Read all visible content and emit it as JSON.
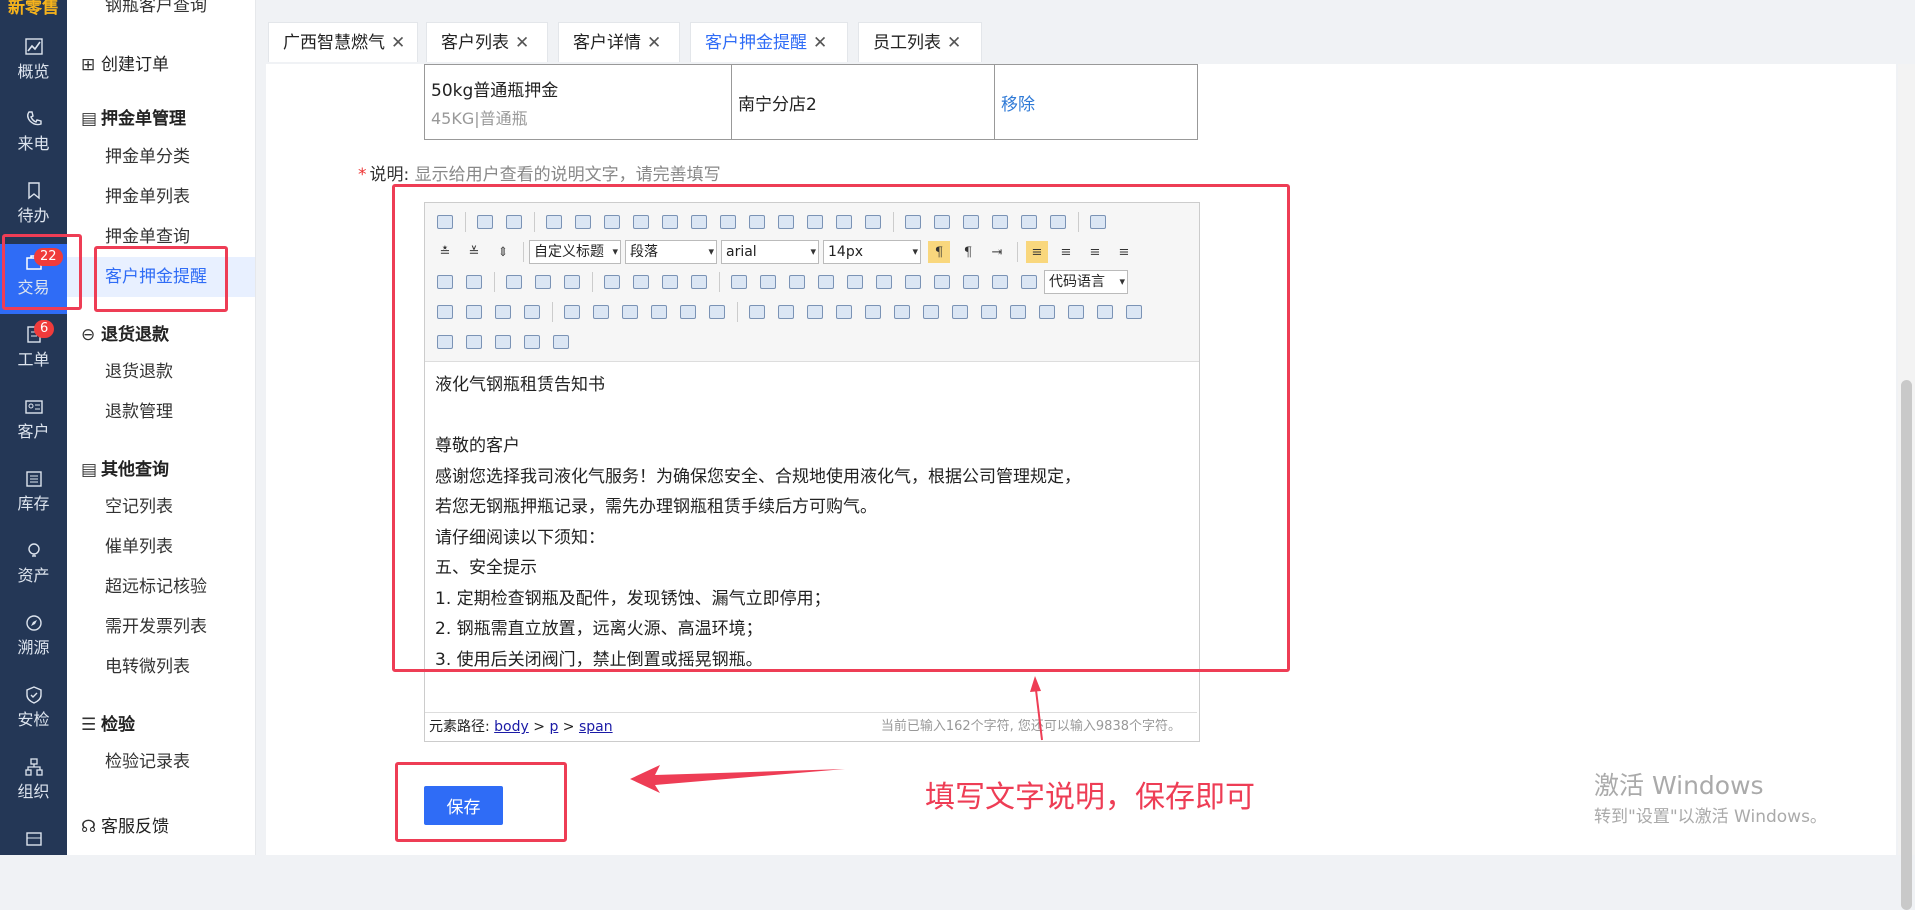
{
  "brand": "新零售",
  "rail": [
    {
      "label": "概览",
      "icon": "chart-icon"
    },
    {
      "label": "来电",
      "icon": "phone-icon"
    },
    {
      "label": "待办",
      "icon": "bookmark-icon"
    },
    {
      "label": "交易",
      "icon": "trade-icon",
      "badge": "22",
      "active": true
    },
    {
      "label": "工单",
      "icon": "ticket-icon",
      "badge": "6"
    },
    {
      "label": "客户",
      "icon": "id-card-icon"
    },
    {
      "label": "库存",
      "icon": "list-icon"
    },
    {
      "label": "资产",
      "icon": "bulb-icon"
    },
    {
      "label": "溯源",
      "icon": "compass-icon"
    },
    {
      "label": "安检",
      "icon": "shield-icon"
    },
    {
      "label": "组织",
      "icon": "org-icon"
    },
    {
      "label": "",
      "icon": "more-icon"
    }
  ],
  "menu": {
    "top_cut": "钢瓶客户查询",
    "create_order": "创建订单",
    "deposit_group": "押金单管理",
    "deposit_items": [
      "押金单分类",
      "押金单列表",
      "押金单查询",
      "客户押金提醒"
    ],
    "refund_group": "退货退款",
    "refund_items": [
      "退货退款",
      "退款管理"
    ],
    "other_group": "其他查询",
    "other_items": [
      "空记列表",
      "催单列表",
      "超远标记核验",
      "需开发票列表",
      "电转微列表"
    ],
    "inspect_group": "检验",
    "inspect_items": [
      "检验记录表"
    ],
    "service": "客服反馈"
  },
  "tabs": [
    {
      "label": "广西智慧燃气"
    },
    {
      "label": "客户列表"
    },
    {
      "label": "客户详情"
    },
    {
      "label": "客户押金提醒",
      "active": true
    },
    {
      "label": "员工列表"
    }
  ],
  "deposit_row": {
    "name": "50kg普通瓶押金",
    "spec": "45KG|普通瓶",
    "store": "南宁分店2",
    "action": "移除"
  },
  "description": {
    "label": "说明:",
    "hint": "显示给用户查看的说明文字，请完善填写"
  },
  "toolbar": {
    "heading_select": "自定义标题",
    "paragraph_select": "段落",
    "font_select": "arial",
    "size_select": "14px",
    "code_select": "代码语言"
  },
  "editor_lines": [
    "液化气钢瓶租赁告知书",
    "",
    "尊敬的客户",
    "感谢您选择我司液化气服务！为确保您安全、合规地使用液化气，根据公司管理规定，",
    "若您无钢瓶押瓶记录，需先办理钢瓶租赁手续后方可购气。",
    "请仔细阅读以下须知：",
    "五、安全提示",
    "1. 定期检查钢瓶及配件，发现锈蚀、漏气立即停用；",
    "2. 钢瓶需直立放置，远离火源、高温环境；",
    "3. 使用后关闭阀门，禁止倒置或摇晃钢瓶。"
  ],
  "statusbar": {
    "path_label": "元素路径:",
    "path": [
      "body",
      "p",
      "span"
    ],
    "count": "当前已输入162个字符, 您还可以输入9838个字符。"
  },
  "save_label": "保存",
  "annotation": "填写文字说明，保存即可",
  "watermark": {
    "line1": "激活 Windows",
    "line2": "转到\"设置\"以激活 Windows。"
  }
}
